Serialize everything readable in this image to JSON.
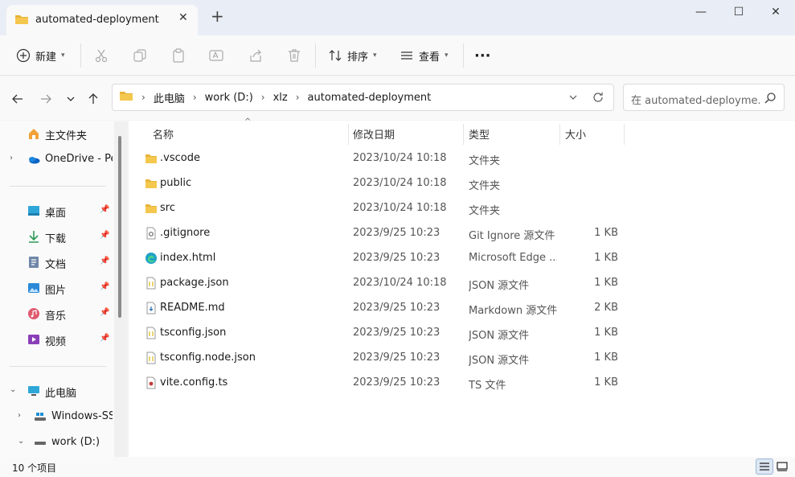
{
  "window": {
    "tab_title": "automated-deployment",
    "new_tab": "+",
    "controls": {
      "minimize": "—",
      "maximize": "☐",
      "close": "✕"
    }
  },
  "toolbar": {
    "new_label": "新建",
    "sort_label": "排序",
    "view_label": "查看",
    "more_label": "···",
    "icons": [
      "cut-icon",
      "copy-icon",
      "paste-icon",
      "rename-icon",
      "share-icon",
      "delete-icon"
    ]
  },
  "address": {
    "crumbs": [
      "此电脑",
      "work (D:)",
      "xlz",
      "automated-deployment"
    ]
  },
  "search": {
    "placeholder": "在 automated-deployme..."
  },
  "sidebar": {
    "items": [
      {
        "label": "主文件夹",
        "icon": "home-icon",
        "pinned": false
      },
      {
        "label": "OneDrive - Per",
        "icon": "onedrive-icon",
        "pinned": false
      },
      {
        "label": "桌面",
        "icon": "desktop-icon",
        "pinned": true
      },
      {
        "label": "下载",
        "icon": "download-icon",
        "pinned": true
      },
      {
        "label": "文档",
        "icon": "documents-icon",
        "pinned": true
      },
      {
        "label": "图片",
        "icon": "pictures-icon",
        "pinned": true
      },
      {
        "label": "音乐",
        "icon": "music-icon",
        "pinned": true
      },
      {
        "label": "视频",
        "icon": "videos-icon",
        "pinned": true
      },
      {
        "label": "此电脑",
        "icon": "this-pc-icon",
        "pinned": false
      },
      {
        "label": "Windows-SSD",
        "icon": "drive-c-icon",
        "pinned": false
      },
      {
        "label": "work (D:)",
        "icon": "drive-d-icon",
        "pinned": false
      }
    ]
  },
  "columns": {
    "name": "名称",
    "date": "修改日期",
    "type": "类型",
    "size": "大小"
  },
  "files": [
    {
      "name": ".vscode",
      "date": "2023/10/24 10:18",
      "type": "文件夹",
      "size": "",
      "icon": "folder-icon"
    },
    {
      "name": "public",
      "date": "2023/10/24 10:18",
      "type": "文件夹",
      "size": "",
      "icon": "folder-icon"
    },
    {
      "name": "src",
      "date": "2023/10/24 10:18",
      "type": "文件夹",
      "size": "",
      "icon": "folder-icon"
    },
    {
      "name": ".gitignore",
      "date": "2023/9/25 10:23",
      "type": "Git Ignore 源文件",
      "size": "1 KB",
      "icon": "gear-file-icon"
    },
    {
      "name": "index.html",
      "date": "2023/9/25 10:23",
      "type": "Microsoft Edge ...",
      "size": "1 KB",
      "icon": "edge-icon"
    },
    {
      "name": "package.json",
      "date": "2023/10/24 10:18",
      "type": "JSON 源文件",
      "size": "1 KB",
      "icon": "json-file-icon"
    },
    {
      "name": "README.md",
      "date": "2023/9/25 10:23",
      "type": "Markdown 源文件",
      "size": "2 KB",
      "icon": "markdown-file-icon"
    },
    {
      "name": "tsconfig.json",
      "date": "2023/9/25 10:23",
      "type": "JSON 源文件",
      "size": "1 KB",
      "icon": "json-file-icon"
    },
    {
      "name": "tsconfig.node.json",
      "date": "2023/9/25 10:23",
      "type": "JSON 源文件",
      "size": "1 KB",
      "icon": "json-file-icon"
    },
    {
      "name": "vite.config.ts",
      "date": "2023/9/25 10:23",
      "type": "TS 文件",
      "size": "1 KB",
      "icon": "ts-file-icon"
    }
  ],
  "status": {
    "count": "10 个项目"
  },
  "colors": {
    "folder": "#e8b33a",
    "accent": "#0067c0",
    "edge": "#1fa0c8"
  }
}
